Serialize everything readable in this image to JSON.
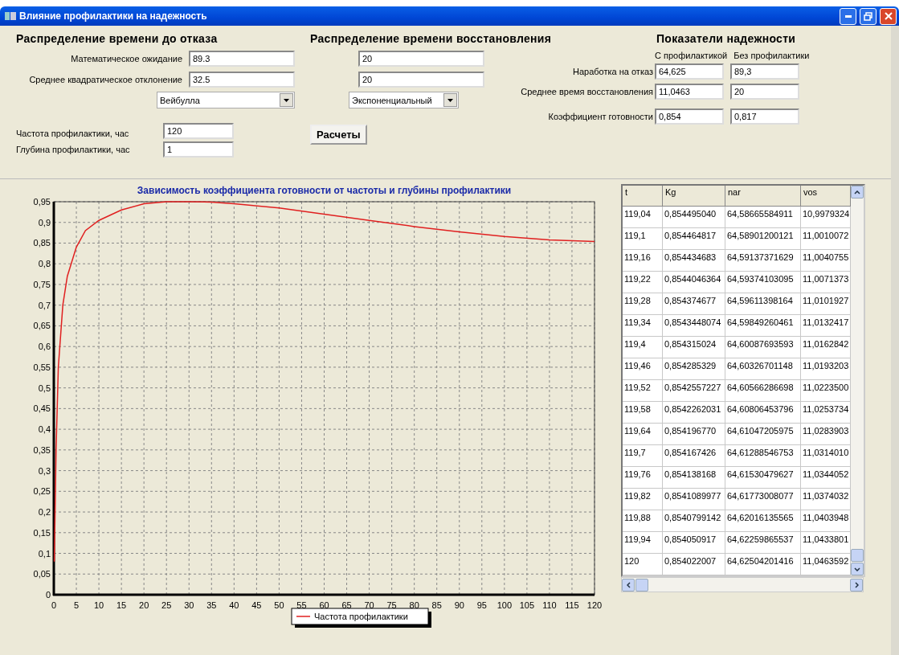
{
  "window": {
    "title": "Влияние профилактики на надежность"
  },
  "failure_distribution": {
    "heading": "Распределение времени до отказа",
    "fields": [
      {
        "label": "Математическое ожидание",
        "value": "89.3"
      },
      {
        "label": "Среднее квадратическое отклонение",
        "value": "32.5"
      }
    ],
    "distribution": "Вейбулла"
  },
  "maintenance": {
    "fields": [
      {
        "label": "Частота профилактики, час",
        "value": "120"
      },
      {
        "label": "Глубина профилактики, час",
        "value": "1"
      }
    ]
  },
  "recovery_distribution": {
    "heading": "Распределение времени восстановления",
    "fields": [
      {
        "value": "20"
      },
      {
        "value": "20"
      }
    ],
    "distribution": "Экспоненциальный",
    "button": "Расчеты"
  },
  "reliability": {
    "heading": "Показатели надежности",
    "columns": [
      "С профилактикой",
      "Без профилактики"
    ],
    "rows": [
      {
        "label": "Наработка на отказ",
        "values": [
          "64,625",
          "89,3"
        ]
      },
      {
        "label": "Среднее время восстановления",
        "values": [
          "11,0463",
          "20"
        ]
      },
      {
        "label": "Коэффициент готовности",
        "values": [
          "0,854",
          "0,817"
        ]
      }
    ]
  },
  "chart": {
    "chart_data": {
      "type": "line",
      "title": "Зависимость коэффициента готовности от частоты и глубины профилактики",
      "x": [
        0.1,
        0.5,
        1,
        2,
        3,
        5,
        7,
        10,
        15,
        20,
        25,
        30,
        35,
        40,
        50,
        60,
        70,
        80,
        90,
        100,
        110,
        120
      ],
      "series": [
        {
          "name": "Частота профилактики",
          "color": "#e02020",
          "values": [
            0.08,
            0.35,
            0.55,
            0.7,
            0.77,
            0.84,
            0.88,
            0.905,
            0.93,
            0.945,
            0.95,
            0.95,
            0.949,
            0.945,
            0.935,
            0.92,
            0.905,
            0.89,
            0.877,
            0.866,
            0.858,
            0.854
          ]
        }
      ],
      "xlim": [
        0,
        120
      ],
      "ylim": [
        0,
        0.95
      ],
      "grid": true,
      "xticks": [
        0,
        5,
        10,
        15,
        20,
        25,
        30,
        35,
        40,
        45,
        50,
        55,
        60,
        65,
        70,
        75,
        80,
        85,
        90,
        95,
        100,
        105,
        110,
        115,
        120
      ],
      "yticks": [
        0,
        {
          "value": 0.05,
          "label": "0,05"
        },
        {
          "value": 0.1,
          "label": "0,1"
        },
        {
          "value": 0.15,
          "label": "0,15"
        },
        {
          "value": 0.2,
          "label": "0,2"
        },
        {
          "value": 0.25,
          "label": "0,25"
        },
        {
          "value": 0.3,
          "label": "0,3"
        },
        {
          "value": 0.35,
          "label": "0,35"
        },
        {
          "value": 0.4,
          "label": "0,4"
        },
        {
          "value": 0.45,
          "label": "0,45"
        },
        {
          "value": 0.5,
          "label": "0,5"
        },
        {
          "value": 0.55,
          "label": "0,55"
        },
        {
          "value": 0.6,
          "label": "0,6"
        },
        {
          "value": 0.65,
          "label": "0,65"
        },
        {
          "value": 0.7,
          "label": "0,7"
        },
        {
          "value": 0.75,
          "label": "0,75"
        },
        {
          "value": 0.8,
          "label": "0,8"
        },
        {
          "value": 0.85,
          "label": "0,85"
        },
        {
          "value": 0.9,
          "label": "0,9"
        },
        {
          "value": 0.95,
          "label": "0,95"
        }
      ]
    }
  },
  "table": {
    "columns": [
      "t",
      "Kg",
      "nar",
      "vos"
    ],
    "rows": [
      [
        "119,04",
        "0,854495040",
        "64,58665584911",
        "10,9979324"
      ],
      [
        "119,1",
        "0,854464817",
        "64,58901200121",
        "11,0010072"
      ],
      [
        "119,16",
        "0,854434683",
        "64,59137371629",
        "11,0040755"
      ],
      [
        "119,22",
        "0,8544046364",
        "64,59374103095",
        "11,0071373"
      ],
      [
        "119,28",
        "0,854374677",
        "64,59611398164",
        "11,0101927"
      ],
      [
        "119,34",
        "0,8543448074",
        "64,59849260461",
        "11,0132417"
      ],
      [
        "119,4",
        "0,854315024",
        "64,60087693593",
        "11,0162842"
      ],
      [
        "119,46",
        "0,854285329",
        "64,60326701148",
        "11,0193203"
      ],
      [
        "119,52",
        "0,8542557227",
        "64,60566286698",
        "11,0223500"
      ],
      [
        "119,58",
        "0,8542262031",
        "64,60806453796",
        "11,0253734"
      ],
      [
        "119,64",
        "0,854196770",
        "64,61047205975",
        "11,0283903"
      ],
      [
        "119,7",
        "0,854167426",
        "64,61288546753",
        "11,0314010"
      ],
      [
        "119,76",
        "0,854138168",
        "64,61530479627",
        "11,0344052"
      ],
      [
        "119,82",
        "0,8541089977",
        "64,61773008077",
        "11,0374032"
      ],
      [
        "119,88",
        "0,8540799142",
        "64,62016135565",
        "11,0403948"
      ],
      [
        "119,94",
        "0,854050917",
        "64,62259865537",
        "11,0433801"
      ],
      [
        "120",
        "0,854022007",
        "64,62504201416",
        "11,0463592"
      ]
    ]
  }
}
